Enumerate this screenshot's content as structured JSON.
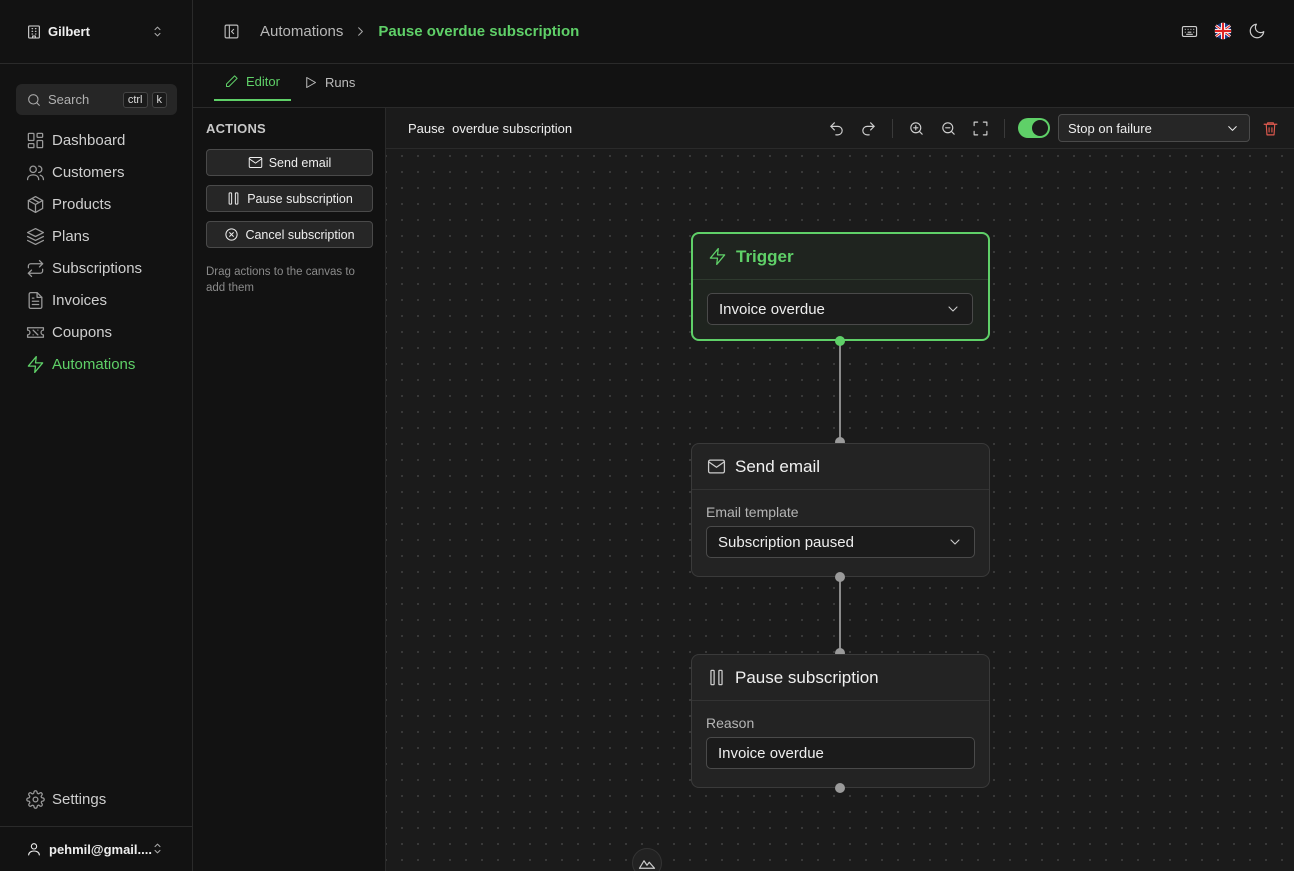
{
  "org": {
    "name": "Gilbert"
  },
  "search": {
    "placeholder": "Search",
    "kbd1": "ctrl",
    "kbd2": "k"
  },
  "nav": [
    {
      "label": "Dashboard",
      "icon": "dashboard-icon"
    },
    {
      "label": "Customers",
      "icon": "users-icon"
    },
    {
      "label": "Products",
      "icon": "box-icon"
    },
    {
      "label": "Plans",
      "icon": "layers-icon"
    },
    {
      "label": "Subscriptions",
      "icon": "repeat-icon"
    },
    {
      "label": "Invoices",
      "icon": "file-icon"
    },
    {
      "label": "Coupons",
      "icon": "ticket-icon"
    },
    {
      "label": "Automations",
      "icon": "zap-icon",
      "active": true
    }
  ],
  "settings": {
    "label": "Settings"
  },
  "user": {
    "email": "pehmil@gmail...."
  },
  "breadcrumb": {
    "parent": "Automations",
    "current": "Pause overdue subscription"
  },
  "tabs": {
    "editor": "Editor",
    "runs": "Runs"
  },
  "actions": {
    "title": "ACTIONS",
    "send_email": "Send email",
    "pause_subscription": "Pause subscription",
    "cancel_subscription": "Cancel subscription",
    "hint": "Drag actions to the canvas to add them"
  },
  "toolbar": {
    "flow_name": "Pause  overdue subscription",
    "stop_on_failure": "Stop on failure",
    "toggle_on": true
  },
  "nodes": {
    "trigger": {
      "title": "Trigger",
      "value": "Invoice overdue"
    },
    "send_email": {
      "title": "Send email",
      "field_label": "Email template",
      "value": "Subscription paused"
    },
    "pause": {
      "title": "Pause subscription",
      "field_label": "Reason",
      "value": "Invoice overdue"
    }
  },
  "colors": {
    "accent": "#5fd068",
    "danger": "#e05a4f",
    "background": "#121212",
    "canvas": "#1b1b1b"
  }
}
